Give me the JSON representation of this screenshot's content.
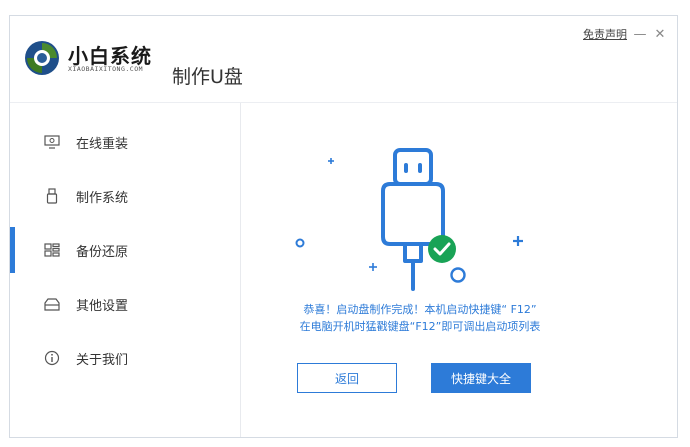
{
  "app": {
    "brand": "小白系统",
    "brand_sub": "XIAOBAIXITONG.COM",
    "page_title": "制作U盘"
  },
  "top_bar": {
    "disclaimer": "免责声明",
    "minimize_glyph": "—",
    "close_glyph": "✕"
  },
  "sidebar": {
    "items": [
      {
        "label": "在线重装",
        "icon": "monitor-icon",
        "active": false
      },
      {
        "label": "制作系统",
        "icon": "usb-icon",
        "active": false
      },
      {
        "label": "备份还原",
        "icon": "grid-icon",
        "active": true
      },
      {
        "label": "其他设置",
        "icon": "box-icon",
        "active": false
      },
      {
        "label": "关于我们",
        "icon": "info-icon",
        "active": false
      }
    ]
  },
  "main": {
    "message_line1": "恭喜！启动盘制作完成！本机启动快捷键“ F12”",
    "message_line2": "在电脑开机时猛戳键盘“F12”即可调出启动项列表",
    "back_button": "返回",
    "hotkeys_button": "快捷键大全"
  },
  "colors": {
    "accent": "#2d7bd8",
    "success": "#19a356"
  }
}
